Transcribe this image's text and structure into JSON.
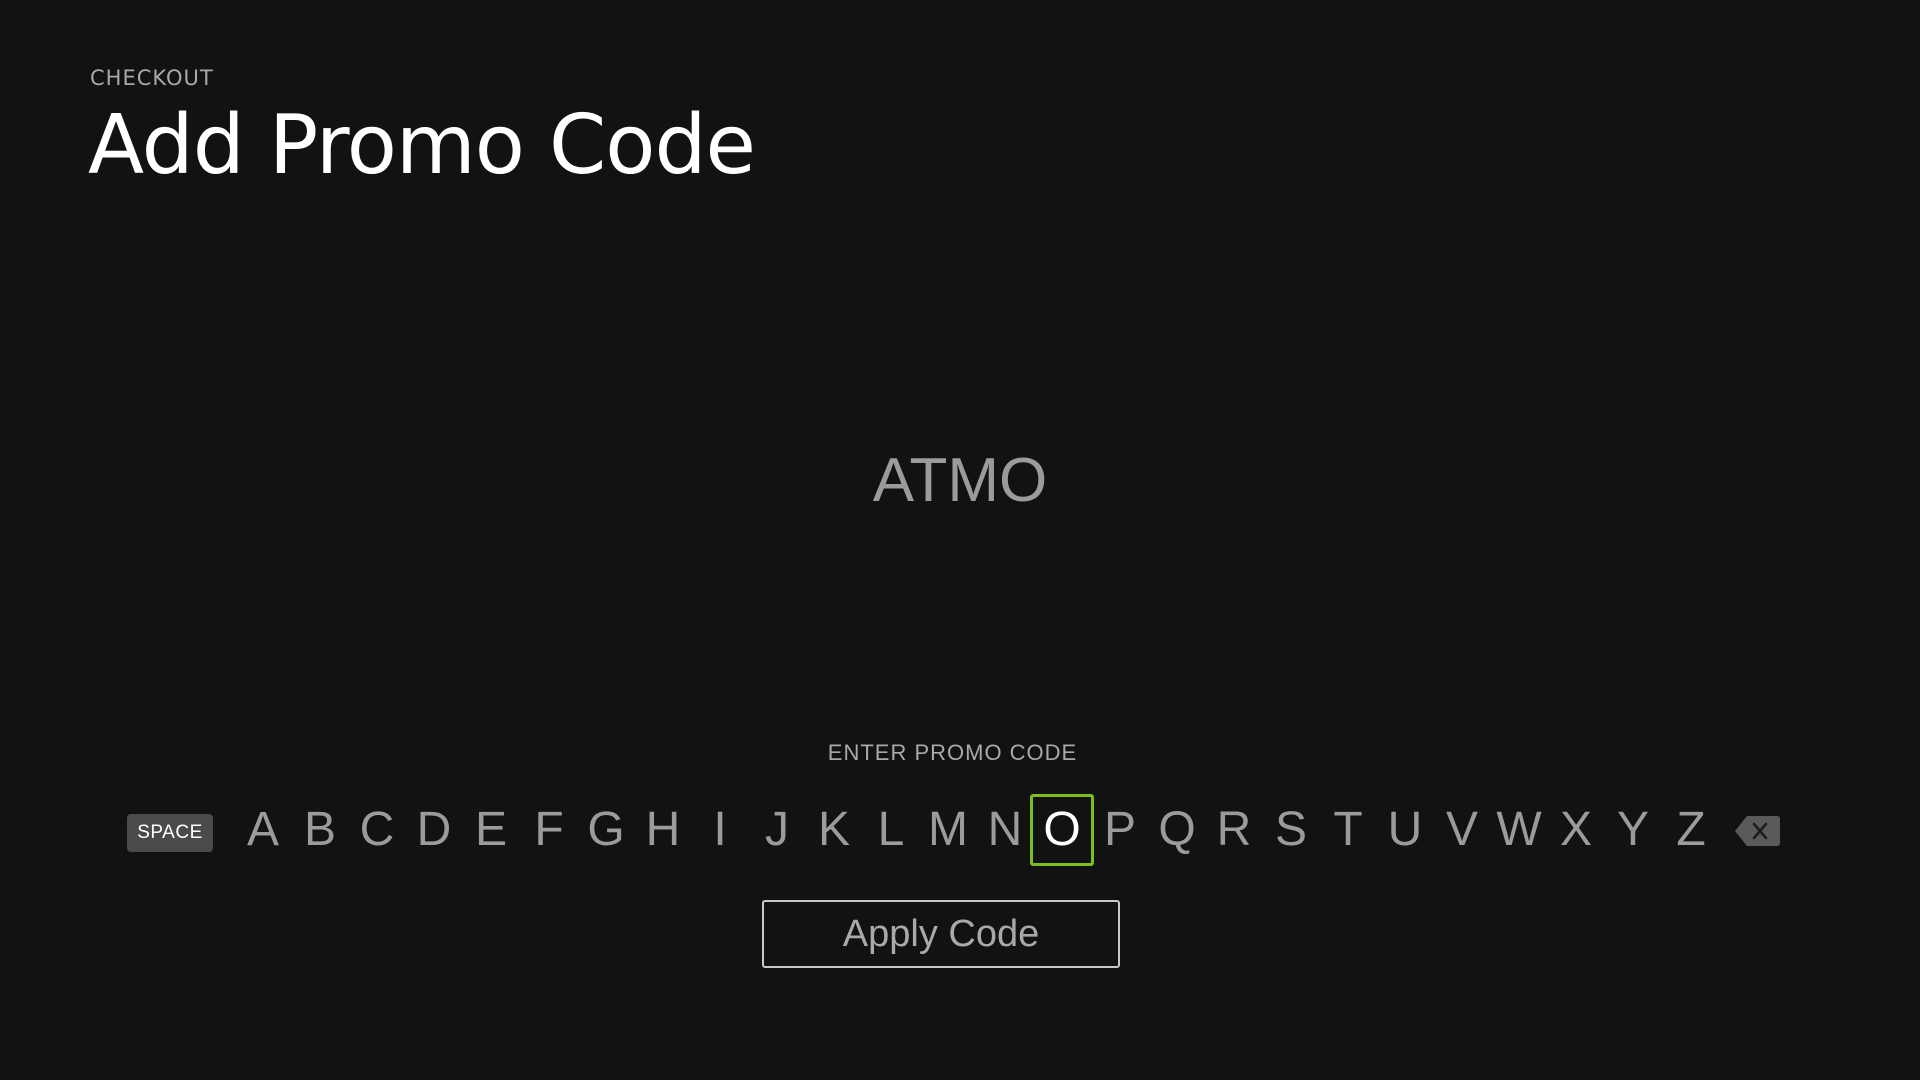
{
  "header": {
    "eyebrow": "CHECKOUT",
    "title": "Add Promo Code"
  },
  "entry": {
    "value": "ATMO",
    "prompt": "ENTER PROMO CODE"
  },
  "keyboard": {
    "space_label": "SPACE",
    "letters": [
      "A",
      "B",
      "C",
      "D",
      "E",
      "F",
      "G",
      "H",
      "I",
      "J",
      "K",
      "L",
      "M",
      "N",
      "O",
      "P",
      "Q",
      "R",
      "S",
      "T",
      "U",
      "V",
      "W",
      "X",
      "Y",
      "Z"
    ],
    "focused_letter": "O",
    "backspace_icon": "backspace-icon",
    "focus_color": "#7ebd1e"
  },
  "actions": {
    "apply_label": "Apply Code"
  }
}
